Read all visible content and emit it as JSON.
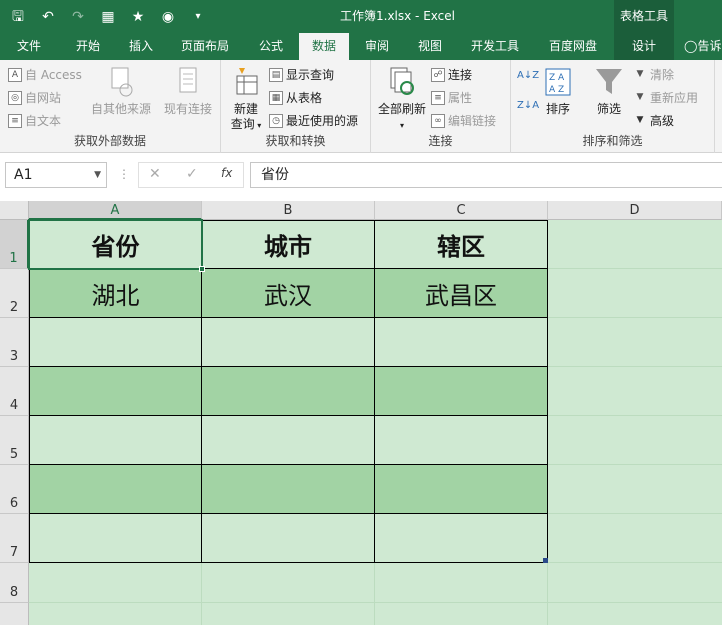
{
  "window": {
    "title": "工作簿1.xlsx - Excel",
    "context_tab_group": "表格工具"
  },
  "qat": {
    "save_icon": "save-icon",
    "undo_icon": "undo-icon",
    "redo_icon": "redo-icon"
  },
  "tabs": [
    {
      "label": "文件"
    },
    {
      "label": "开始"
    },
    {
      "label": "插入"
    },
    {
      "label": "页面布局"
    },
    {
      "label": "公式"
    },
    {
      "label": "数据"
    },
    {
      "label": "审阅"
    },
    {
      "label": "视图"
    },
    {
      "label": "开发工具"
    },
    {
      "label": "百度网盘"
    },
    {
      "label": "设计"
    },
    {
      "label": "告诉"
    }
  ],
  "ribbon": {
    "external": {
      "access": "自 Access",
      "web": "自网站",
      "text": "自文本",
      "other_sources": "自其他来源",
      "existing": "现有连接",
      "group_label": "获取外部数据"
    },
    "transform": {
      "new_query_line1": "新建",
      "new_query_line2": "查询",
      "show_queries": "显示查询",
      "from_table": "从表格",
      "recent_sources": "最近使用的源",
      "group_label": "获取和转换"
    },
    "connections": {
      "refresh_all": "全部刷新",
      "connections": "连接",
      "properties": "属性",
      "edit_links": "编辑链接",
      "group_label": "连接"
    },
    "sort_filter": {
      "sort": "排序",
      "filter": "筛选",
      "clear": "清除",
      "reapply": "重新应用",
      "advanced": "高级",
      "group_label": "排序和筛选"
    }
  },
  "formula_bar": {
    "name_box": "A1",
    "fx": "fx",
    "value": "省份"
  },
  "columns": [
    "A",
    "B",
    "C",
    "D"
  ],
  "rows": [
    "1",
    "2",
    "3",
    "4",
    "5",
    "6",
    "7",
    "8"
  ],
  "table": {
    "headers": [
      "省份",
      "城市",
      "辖区"
    ],
    "rows": [
      [
        "湖北",
        "武汉",
        "武昌区"
      ],
      [
        "",
        "",
        ""
      ],
      [
        "",
        "",
        ""
      ],
      [
        "",
        "",
        ""
      ],
      [
        "",
        "",
        ""
      ],
      [
        "",
        "",
        ""
      ]
    ]
  },
  "colors": {
    "excel_green": "#217346",
    "band_dark": "#a2d3a4",
    "band_light": "#cfe9d2"
  }
}
